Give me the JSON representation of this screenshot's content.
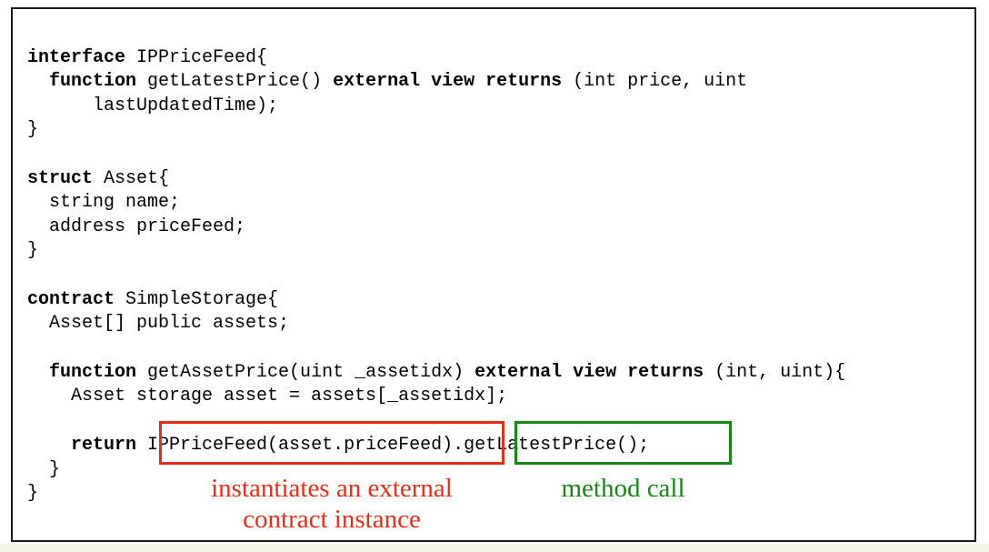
{
  "code": {
    "l1": {
      "kw1": "interface",
      "rest": " IPPriceFeed{"
    },
    "l2": {
      "indent": "  ",
      "kw1": "function",
      "mid": " getLatestPrice() ",
      "kw2": "external view returns",
      "rest": " (int price, uint"
    },
    "l3": {
      "text": "      lastUpdatedTime);"
    },
    "l4": {
      "text": "}"
    },
    "l5": {
      "kw1": "struct",
      "rest": " Asset{"
    },
    "l6": {
      "text": "  string name;"
    },
    "l7": {
      "text": "  address priceFeed;"
    },
    "l8": {
      "text": "}"
    },
    "l9": {
      "kw1": "contract",
      "rest": " SimpleStorage{"
    },
    "l10": {
      "text": "  Asset[] public assets;"
    },
    "l11": {
      "indent": "  ",
      "kw1": "function",
      "mid": " getAssetPrice(uint _assetidx) ",
      "kw2": "external view returns",
      "rest": " (int, uint){"
    },
    "l12": {
      "text": "    Asset storage asset = assets[_assetidx];"
    },
    "l13": {
      "indent": "    ",
      "kw1": "return",
      "a": " IPPriceFeed(asset.priceFeed)",
      "b": ".getLatestPrice();"
    },
    "l14": {
      "text": "  }"
    },
    "l15": {
      "text": "}"
    }
  },
  "annotations": {
    "red_line1": "instantiates an external",
    "red_line2": "contract instance",
    "green": "method call"
  },
  "colors": {
    "red": "#ee2b1a",
    "green": "#148a14"
  }
}
